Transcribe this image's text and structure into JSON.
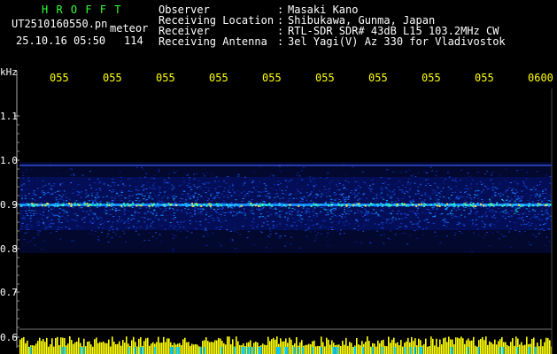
{
  "header": {
    "app_name": "H R O F F T",
    "filename": "UT2510160550.pn",
    "mode": "meteor",
    "datetime": "25.10.16 05:50",
    "count": "114",
    "fields": [
      {
        "label": "Observer",
        "sep": ":",
        "value": "Masaki Kano"
      },
      {
        "label": "Receiving Location",
        "sep": ":",
        "value": "Shibukawa, Gunma, Japan"
      },
      {
        "label": "Receiver",
        "sep": ":",
        "value": "RTL-SDR SDR# 43dB L15 103.2MHz CW"
      },
      {
        "label": "Receiving Antenna",
        "sep": ":",
        "value": "3el Yagi(V) Az 330 for Vladivostok"
      }
    ]
  },
  "y_axis": {
    "unit": "kHz",
    "ticks": [
      "1.1",
      "1.0",
      "0.9",
      "0.8",
      "0.7",
      "0.6"
    ]
  },
  "x_axis": {
    "ticks": [
      "055",
      "055",
      "055",
      "055",
      "055",
      "055",
      "055",
      "055",
      "055",
      "0600"
    ]
  },
  "colors": {
    "background": "#000000",
    "header_title": "#33ff33",
    "text": "#ffffff",
    "time_ticks": "#ffff00",
    "noise_band": "#0a2a9a",
    "signal_line": "#33ffaa",
    "baseline_bars": "#ffff00"
  }
}
